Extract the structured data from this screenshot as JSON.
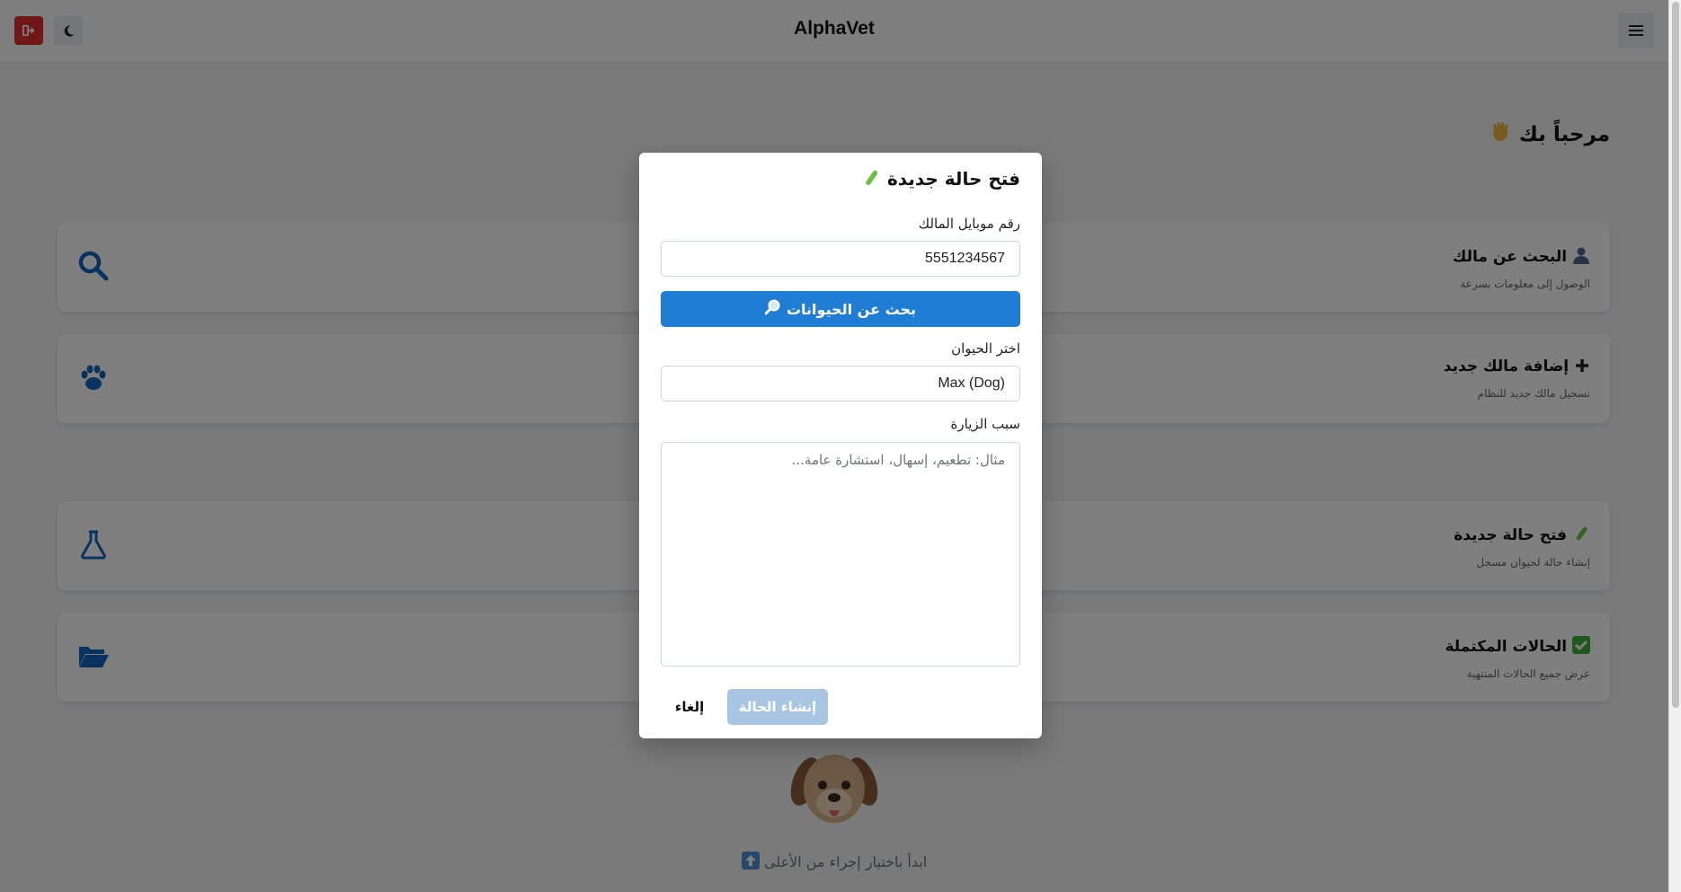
{
  "header": {
    "title": "AlphaVet",
    "logout_icon": "logout-icon",
    "theme_icon": "moon-icon",
    "menu_icon": "hamburger-icon"
  },
  "welcome": {
    "text": "مرحباً بك",
    "icon": "waving-hand-icon"
  },
  "cards": [
    {
      "title": "البحث عن مالك",
      "subtitle": "الوصول إلى معلومات بسرعة",
      "title_icon": "user-icon",
      "icon": "search-icon"
    },
    {
      "title": "إضافة مالك جديد",
      "subtitle": "تسجيل مالك جديد للنظام",
      "title_icon": "plus-icon",
      "icon": "paw-icon"
    },
    {
      "title": "فتح حالة جديدة",
      "subtitle": "إنشاء حالة لحيوان مسجل",
      "title_icon": "test-tube-icon",
      "icon": "flask-icon"
    },
    {
      "title": "الحالات المكتملة",
      "subtitle": "عرض جميع الحالات المنتهية",
      "title_icon": "check-mark-icon",
      "icon": "folder-open-icon"
    }
  ],
  "empty_state": {
    "hint": "ابدأ باختيار إجراء من الأعلى",
    "icon": "dog-face-icon",
    "hint_icon": "up-arrow-icon"
  },
  "modal": {
    "title": "فتح حالة جديدة",
    "title_icon": "test-tube-icon",
    "phone_label": "رقم موبايل المالك",
    "phone_value": "5551234567",
    "search_button": "بحث عن الحيوانات",
    "search_icon": "magnifier-icon",
    "animal_label": "اختر الحيوان",
    "animal_value": "Max (Dog)",
    "reason_label": "سبب الزيارة",
    "reason_placeholder": "مثال: تطعيم، إسهال، استشارة عامة...",
    "create_button": "إنشاء الحالة",
    "cancel_button": "إلغاء"
  },
  "colors": {
    "primary": "#1f7ed4",
    "danger": "#e03131",
    "disabled_primary": "#a8c6e4",
    "icon_blue": "#1565c0"
  }
}
